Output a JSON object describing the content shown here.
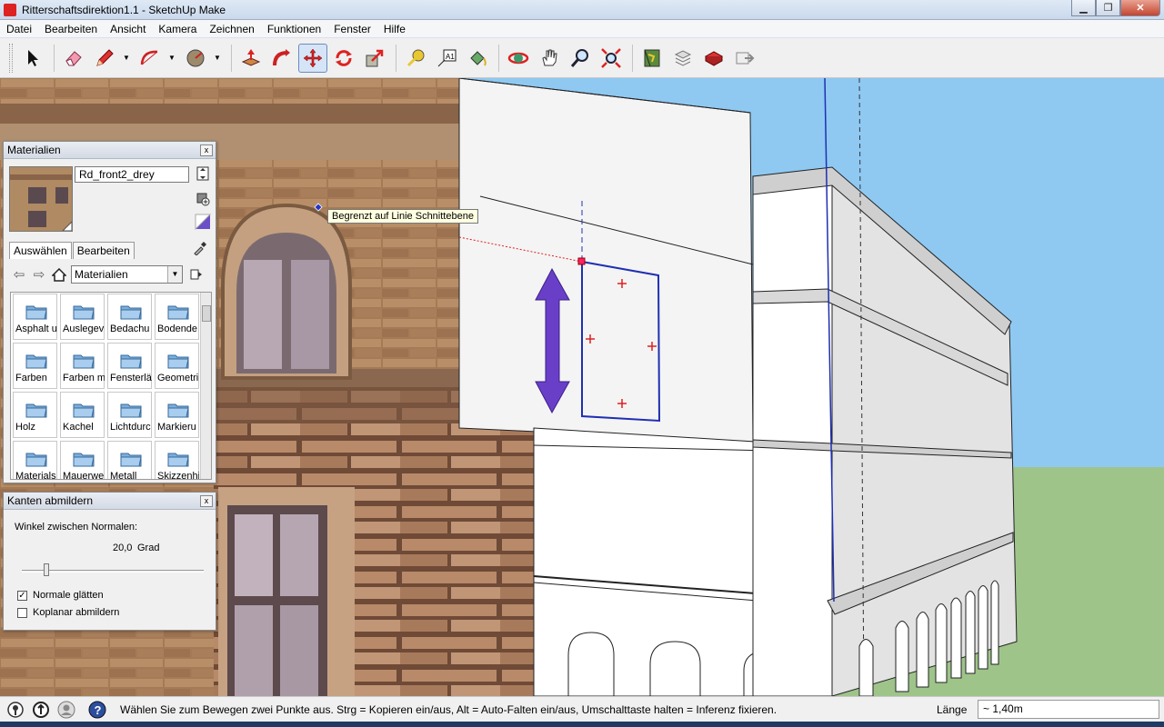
{
  "window": {
    "title": "Ritterschaftsdirektion1.1 - SketchUp Make",
    "minimize": "▁",
    "maximize": "❐",
    "close": "✕"
  },
  "menu": [
    "Datei",
    "Bearbeiten",
    "Ansicht",
    "Kamera",
    "Zeichnen",
    "Funktionen",
    "Fenster",
    "Hilfe"
  ],
  "toolbar": {
    "active_tool": "move-tool",
    "tools": [
      "select",
      "eraser",
      "pencil",
      "arc",
      "circle",
      "push-pull",
      "follow-me",
      "move",
      "rotate",
      "scale",
      "tape-measure",
      "text",
      "paint-bucket",
      "orbit",
      "pan",
      "zoom",
      "zoom-extents",
      "3d-warehouse",
      "share-model",
      "components",
      "extension"
    ]
  },
  "viewport": {
    "tooltip": "Begrenzt auf Linie Schnittebene",
    "colors": {
      "sky": "#8fc9f2",
      "ground": "#9ec48a",
      "selection": "#1f2fb3",
      "move_arrow": "#6a3fc8"
    }
  },
  "materials_panel": {
    "title": "Materialien",
    "close": "x",
    "material_name": "Rd_front2_drey",
    "tabs": [
      "Auswählen",
      "Bearbeiten"
    ],
    "collection": "Materialien",
    "items": [
      "Asphalt u",
      "Auslegev",
      "Bedachu",
      "Bodende",
      "Farben",
      "Farben m",
      "Fensterlä",
      "Geometri",
      "Holz",
      "Kachel",
      "Lichtdurc",
      "Markieru",
      "Materials",
      "Mauerwe",
      "Metall",
      "Skizzenhi"
    ]
  },
  "soften_panel": {
    "title": "Kanten abmildern",
    "close": "x",
    "angle_label": "Winkel zwischen Normalen:",
    "angle_value": "20,0",
    "angle_unit": "Grad",
    "slider_fraction": 0.12,
    "smooth_normals": {
      "label": "Normale glätten",
      "checked": "✓"
    },
    "soften_coplanar": {
      "label": "Koplanar abmildern",
      "checked": ""
    }
  },
  "statusbar": {
    "message": "Wählen Sie zum Bewegen zwei Punkte aus. Strg = Kopieren ein/aus, Alt = Auto-Falten ein/aus, Umschalttaste halten = Inferenz fixieren.",
    "length_label": "Länge",
    "length_value": "~ 1,40m"
  }
}
